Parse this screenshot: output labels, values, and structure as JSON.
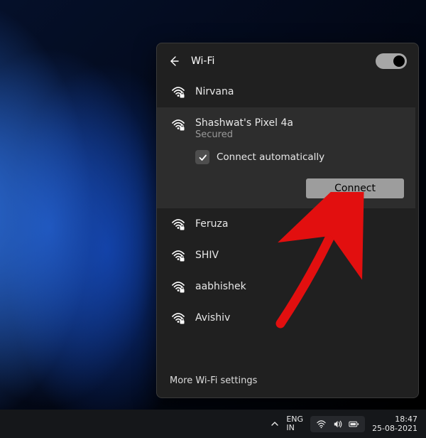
{
  "flyout": {
    "title": "Wi-Fi",
    "toggle_on": true,
    "connect_auto_label": "Connect automatically",
    "connect_auto_checked": true,
    "connect_button": "Connect",
    "footer": "More Wi-Fi settings"
  },
  "networks": [
    {
      "name": "Nirvana",
      "secured": true,
      "selected": false
    },
    {
      "name": "Shashwat's Pixel 4a",
      "secured": true,
      "selected": true,
      "status": "Secured"
    },
    {
      "name": "Feruza",
      "secured": true,
      "selected": false
    },
    {
      "name": "SHIV",
      "secured": true,
      "selected": false
    },
    {
      "name": "aabhishek",
      "secured": true,
      "selected": false
    },
    {
      "name": "Avishiv",
      "secured": true,
      "selected": false
    }
  ],
  "taskbar": {
    "lang1": "ENG",
    "lang2": "IN",
    "time": "18:47",
    "date": "25-08-2021"
  },
  "icons": {
    "back": "back-arrow-icon",
    "wifi": "wifi-secured-icon",
    "check": "checkmark-icon",
    "chevron": "chevron-up-icon",
    "speaker": "speaker-icon",
    "battery": "battery-icon"
  }
}
